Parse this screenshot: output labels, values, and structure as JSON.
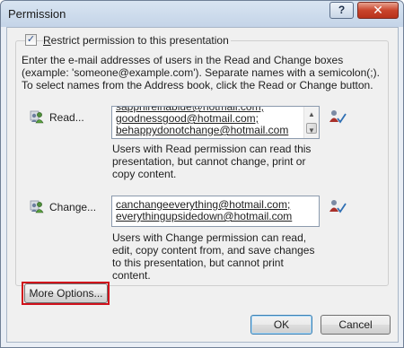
{
  "window": {
    "title": "Permission",
    "help_label": "?",
    "close_label": "✕"
  },
  "restrict": {
    "checked": true,
    "check_glyph": "✓",
    "label_before": "",
    "label_mnemonic": "R",
    "label_after": "estrict permission to this presentation"
  },
  "instructions": "Enter the e-mail addresses of users in the Read and Change boxes (example: 'someone@example.com'). Separate names with a semicolon(;). To select names from the Address book, click the Read or Change button.",
  "read": {
    "label": "Read...",
    "icon": "users-icon",
    "entries": [
      "sapphireinablue@hotmail.com;",
      "goodnessgood@hotmail.com;",
      "behappydonotchange@hotmail.com"
    ],
    "description": "Users with Read permission can read this presentation, but cannot change, print or copy content."
  },
  "change": {
    "label": "Change...",
    "icon": "users-icon",
    "entries": [
      "canchangeeverything@hotmail.com;",
      "everythingupsidedown@hotmail.com"
    ],
    "description": "Users with Change permission can read, edit, copy content from, and save changes to this presentation, but cannot print content."
  },
  "check_names_icon": "check-names-icon",
  "buttons": {
    "more_options": "More Options...",
    "ok": "OK",
    "cancel": "Cancel"
  },
  "colors": {
    "highlight": "#d0101b",
    "title_bar": "#c4d4e8",
    "close_button": "#c9452c"
  }
}
